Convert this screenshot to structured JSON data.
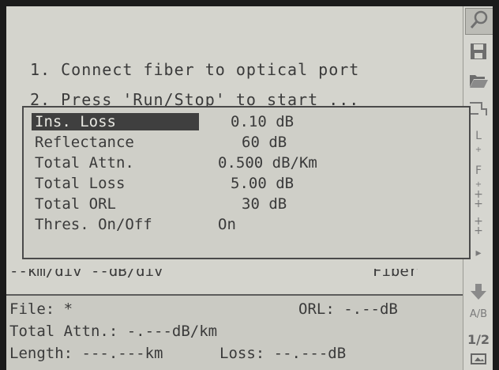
{
  "instructions": {
    "step1": "1. Connect fiber to optical port",
    "step2": "2. Press 'Run/Stop' to start ..."
  },
  "settings_popup": {
    "rows": [
      {
        "label": "Ins. Loss",
        "value": "0.10 dB",
        "selected": true
      },
      {
        "label": "Reflectance",
        "value": "60 dB",
        "selected": false
      },
      {
        "label": "Total Attn.",
        "value": "0.500 dB/Km",
        "selected": false
      },
      {
        "label": "Total Loss",
        "value": "5.00 dB",
        "selected": false
      },
      {
        "label": "Total ORL",
        "value": "30 dB",
        "selected": false
      },
      {
        "label": "Thres. On/Off",
        "value": "On",
        "selected": false
      }
    ]
  },
  "scale_header": {
    "left": "--km/div --dB/div",
    "right": "Fiber"
  },
  "results": {
    "file_label": "File: *",
    "orl": "ORL: -.--dB",
    "total_attn": "Total Attn.: -.---dB/km",
    "length": "Length: ---.---km",
    "loss": "Loss: --.---dB"
  },
  "sidebar": {
    "items": [
      "search-icon",
      "save-icon",
      "open-folder-icon",
      "trace-icon",
      "marker-l-icon",
      "marker-f-icon",
      "marker-add-icon",
      "marker-move-icon",
      "arrow-right-icon",
      "arrow-down-icon",
      "ab-icon",
      "page-indicator-icon"
    ],
    "ab_label": "A/B",
    "page": "1/2"
  },
  "colors": {
    "screen_bg": "#d4d4cd",
    "selection_bg": "#3f3f3f",
    "text": "#3a3a3a"
  }
}
